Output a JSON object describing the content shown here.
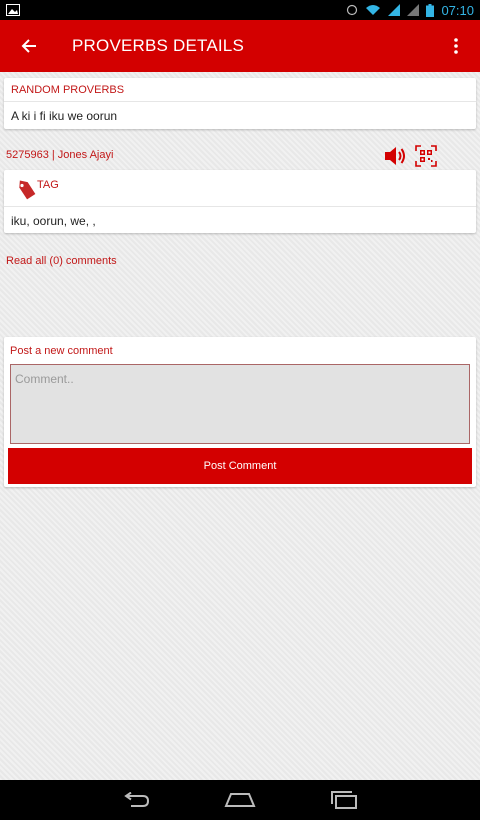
{
  "status_bar": {
    "time": "07:10"
  },
  "app_bar": {
    "title": "PROVERBS DETAILS"
  },
  "proverb_card": {
    "header": "RANDOM PROVERBS",
    "text": "A ki i fi iku we oorun"
  },
  "meta": {
    "text": "5275963 | Jones Ajayi"
  },
  "tag_card": {
    "label": "TAG",
    "tags": "iku, oorun, we, ,"
  },
  "comments": {
    "read_all": "Read all (0) comments"
  },
  "comment_form": {
    "title": "Post a new comment",
    "placeholder": "Comment..",
    "submit_label": "Post Comment"
  },
  "colors": {
    "accent": "#d30000",
    "label_red": "#c21818",
    "background": "#ececec"
  },
  "icons": [
    "back-arrow-icon",
    "overflow-menu-icon",
    "speaker-icon",
    "qr-code-icon",
    "tag-icon",
    "nav-back-icon",
    "nav-home-icon",
    "nav-recents-icon"
  ]
}
